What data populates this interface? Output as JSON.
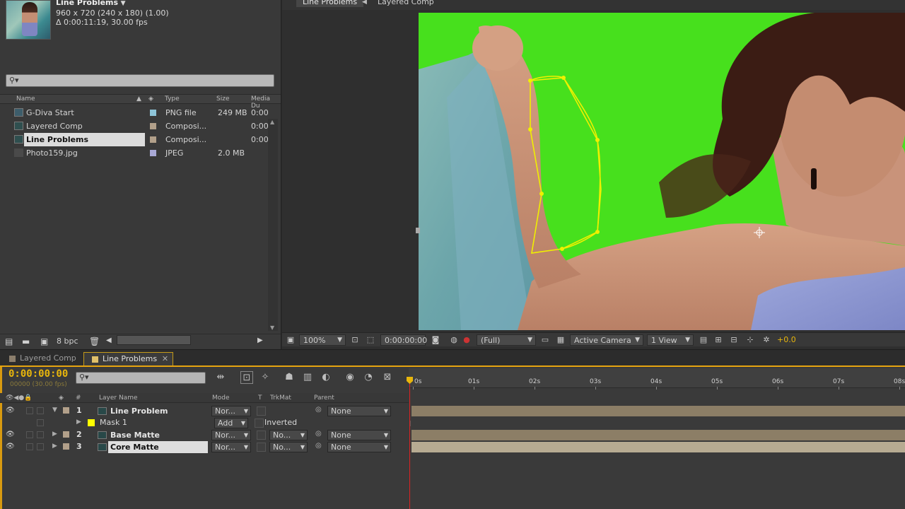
{
  "project": {
    "comp_name": "Line Problems",
    "comp_info_line1": "960 x 720  (240 x 180) (1.00)",
    "comp_info_line2": "Δ 0:00:11:19, 30.00 fps",
    "search_placeholder": "",
    "columns": {
      "name": "Name",
      "type": "Type",
      "size": "Size",
      "duration": "Media Du"
    },
    "items": [
      {
        "name": "G-Diva Start",
        "label_color": "#8ec4d8",
        "type": "PNG file",
        "size": "249 MB",
        "duration": "0:00",
        "icon": "image-file-icon",
        "selected": false
      },
      {
        "name": "Layered Comp",
        "label_color": "#b2a08a",
        "type": "Composi...",
        "size": "",
        "duration": "0:00",
        "icon": "composition-icon",
        "selected": false
      },
      {
        "name": "Line Problems",
        "label_color": "#b2a08a",
        "type": "Composi...",
        "size": "",
        "duration": "0:00",
        "icon": "composition-icon",
        "selected": true
      },
      {
        "name": "Photo159.jpg",
        "label_color": "#a9a9d6",
        "type": "JPEG",
        "size": "2.0 MB",
        "duration": "",
        "icon": "image-file-icon",
        "selected": false
      }
    ],
    "footer": {
      "bit_depth": "8 bpc"
    }
  },
  "viewer": {
    "tabs": [
      {
        "label": "Line Problems",
        "active": true
      },
      {
        "label": "Layered Comp",
        "active": false
      }
    ],
    "zoom": "100%",
    "timecode": "0:00:00:00",
    "resolution": "(Full)",
    "camera": "Active Camera",
    "views": "1 View",
    "exposure": "+0.0"
  },
  "timeline": {
    "tabs": [
      {
        "label": "Layered Comp",
        "active": false,
        "color": "#8b7e6c"
      },
      {
        "label": "Line Problems",
        "active": true,
        "color": "#e0c06a"
      }
    ],
    "current_time": "0:00:00:00",
    "fps_note": "00000 (30.00 fps)",
    "ruler_ticks": [
      "0s",
      "01s",
      "02s",
      "03s",
      "04s",
      "05s",
      "06s",
      "07s",
      "08s"
    ],
    "columns": {
      "num": "#",
      "layer_name": "Layer Name",
      "mode": "Mode",
      "t": "T",
      "trkmat": "TrkMat",
      "parent": "Parent"
    },
    "layers": [
      {
        "num": "1",
        "name": "Line Problem",
        "mode": "Nor...",
        "trkmat": "",
        "parent": "None",
        "expanded": true,
        "selected": false,
        "bar_color": "#8c7e66"
      },
      {
        "num": "2",
        "name": "Base Matte",
        "mode": "Nor...",
        "trkmat": "No...",
        "parent": "None",
        "expanded": false,
        "selected": false,
        "bar_color": "#8c7e66"
      },
      {
        "num": "3",
        "name": "Core Matte",
        "mode": "Nor...",
        "trkmat": "No...",
        "parent": "None",
        "expanded": false,
        "selected": true,
        "bar_color": "#b7ab92"
      }
    ],
    "mask": {
      "name": "Mask 1",
      "mode": "Add",
      "inverted_label": "Inverted",
      "color": "#ffff00"
    }
  }
}
